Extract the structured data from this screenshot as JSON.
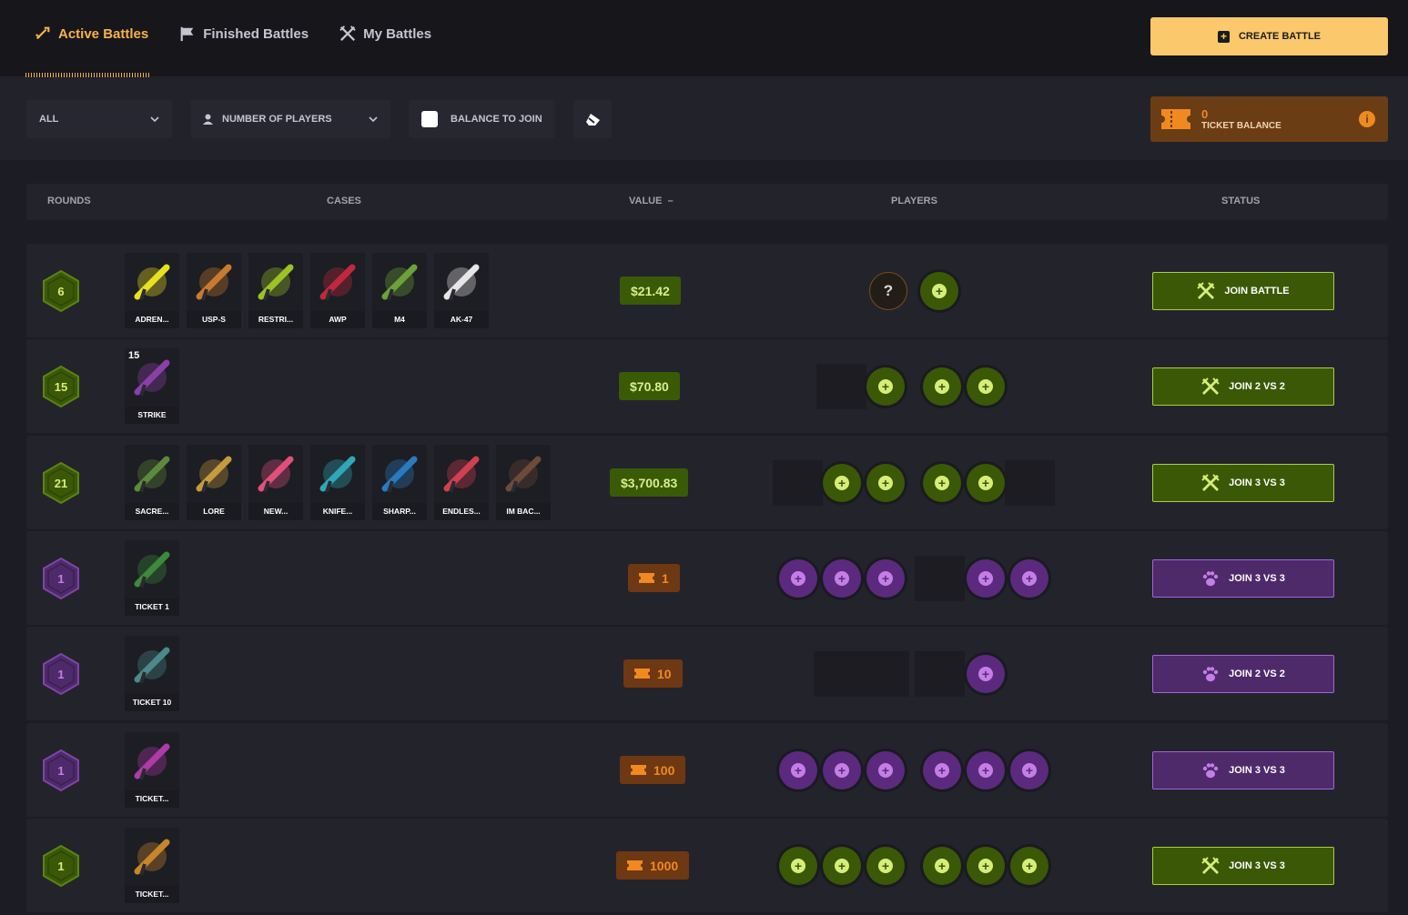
{
  "nav": {
    "active": "Active Battles",
    "finished": "Finished Battles",
    "mine": "My Battles"
  },
  "create_button": "CREATE BATTLE",
  "filters": {
    "mode": "ALL",
    "players": "NUMBER OF PLAYERS",
    "balance": "BALANCE TO JOIN"
  },
  "ticket_balance": {
    "value": "0",
    "label": "TICKET BALANCE"
  },
  "table_headers": {
    "rounds": "ROUNDS",
    "cases": "CASES",
    "value": "VALUE",
    "sort": "–",
    "players": "PLAYERS",
    "status": "STATUS"
  },
  "colors": {
    "accent": "#fbc86b",
    "green": "#3b5807",
    "purple": "#5b2a7e",
    "orange": "#f08a20"
  },
  "rows": [
    {
      "rounds": "6",
      "theme": "green",
      "cases": [
        {
          "label": "ADREN...",
          "art": "#e8e020"
        },
        {
          "label": "USP-S",
          "art": "#c97a2c"
        },
        {
          "label": "RESTRI...",
          "art": "#9cc226"
        },
        {
          "label": "AWP",
          "art": "#c0283c"
        },
        {
          "label": "M4",
          "art": "#6ca23a"
        },
        {
          "label": "AK-47",
          "art": "#e6e6e6"
        }
      ],
      "value": "$21.42",
      "status": "JOIN BATTLE"
    },
    {
      "rounds": "15",
      "theme": "green",
      "cases": [
        {
          "label": "STRIKE",
          "count": "15",
          "art": "#8b3fa8"
        }
      ],
      "value": "$70.80",
      "status": "JOIN 2 VS 2"
    },
    {
      "rounds": "21",
      "theme": "green",
      "cases": [
        {
          "label": "SACRE...",
          "art": "#5c8a3a"
        },
        {
          "label": "LORE",
          "art": "#c79a3b"
        },
        {
          "label": "NEW...",
          "art": "#e0507a"
        },
        {
          "label": "KNIFE...",
          "art": "#2ea8b8"
        },
        {
          "label": "SHARP...",
          "art": "#2a7ac0"
        },
        {
          "label": "ENDLES...",
          "art": "#d04050"
        },
        {
          "label": "IM BAC...",
          "art": "#6e4a3a"
        }
      ],
      "value": "$3,700.83",
      "status": "JOIN 3 VS 3"
    },
    {
      "rounds": "1",
      "theme": "purple",
      "cases": [
        {
          "label": "TICKET 1",
          "art": "#3d8a3a"
        }
      ],
      "value": "1",
      "status": "JOIN 3 VS 3"
    },
    {
      "rounds": "1",
      "theme": "purple",
      "cases": [
        {
          "label": "TICKET 10",
          "art": "#4a8a8a"
        }
      ],
      "value": "10",
      "status": "JOIN 2 VS 2"
    },
    {
      "rounds": "1",
      "theme": "purple",
      "cases": [
        {
          "label": "TICKET...",
          "art": "#b03aa8"
        }
      ],
      "value": "100",
      "status": "JOIN 3 VS 3"
    },
    {
      "rounds": "1",
      "theme": "green",
      "cases": [
        {
          "label": "TICKET...",
          "art": "#c8862a"
        }
      ],
      "value": "1000",
      "status": "JOIN 3 VS 3"
    }
  ]
}
